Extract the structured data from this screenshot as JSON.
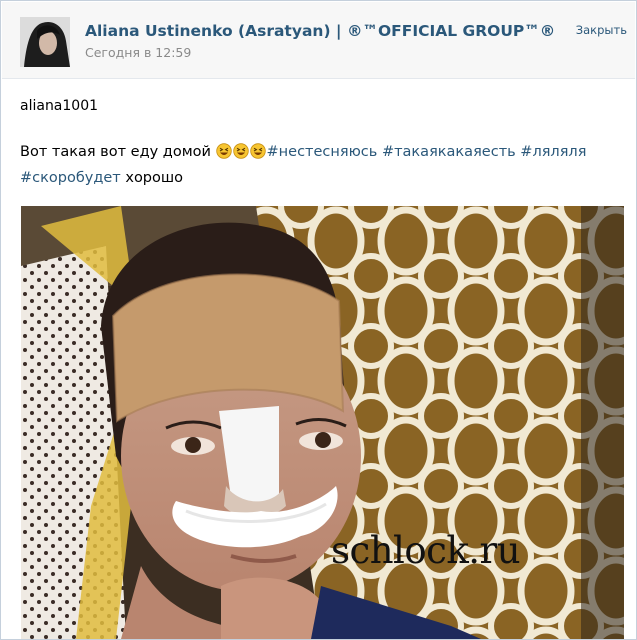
{
  "post": {
    "author": "Aliana Ustinenko (Asratyan) | ®™OFFICIAL GROUP™®",
    "date": "Сегодня в 12:59",
    "close_label": "Закрыть",
    "username": "aliana1001",
    "text_start": "Вот такая вот еду домой ",
    "emojis": [
      "grinning-squinting-face",
      "grinning-squinting-face",
      "grinning-squinting-face"
    ],
    "hashtags": [
      "#нестесняюсь",
      "#такаякакаяесть",
      "#ляляля",
      "#скоробудет"
    ],
    "text_end": " хорошо",
    "photo_alt": "selfie with bandaged face",
    "watermark": "schlock.ru"
  },
  "colors": {
    "link": "#2b587a",
    "header_bg": "#f7f7f7",
    "muted": "#8a8a8a"
  }
}
